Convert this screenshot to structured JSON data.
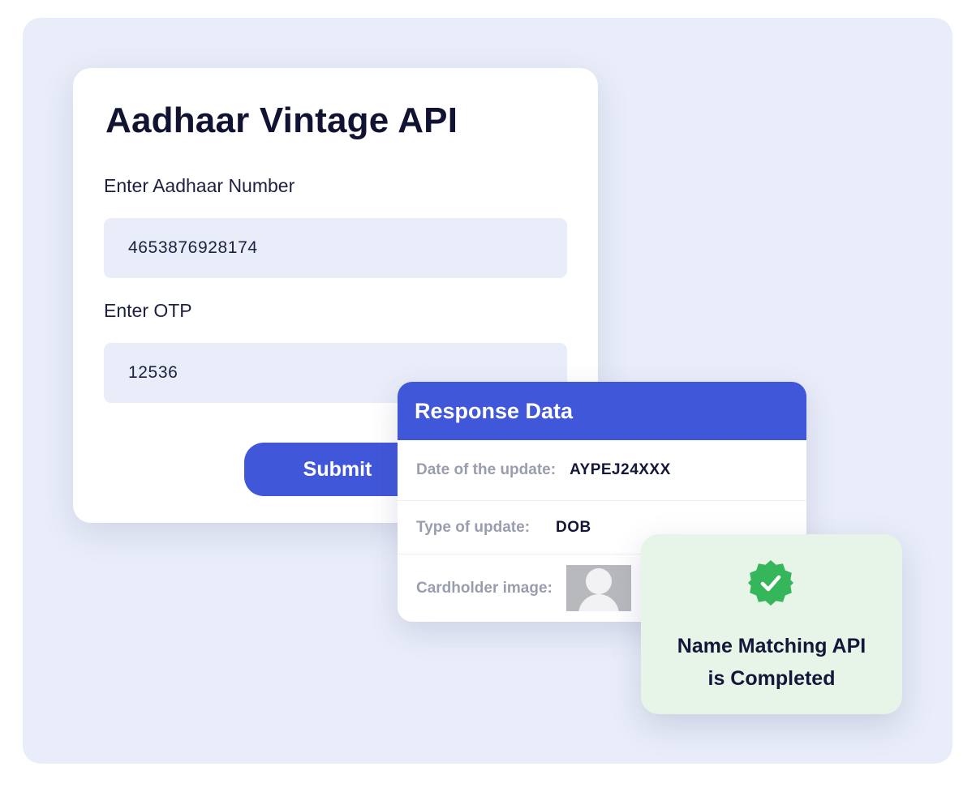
{
  "form": {
    "title": "Aadhaar Vintage API",
    "aadhaar_label": "Enter Aadhaar Number",
    "aadhaar_value": "4653876928174",
    "otp_label": "Enter OTP",
    "otp_value": "12536",
    "submit_label": "Submit"
  },
  "response": {
    "title": "Response Data",
    "rows": [
      {
        "label": "Date of the update:",
        "value": "AYPEJ24XXX"
      },
      {
        "label": "Type of update:",
        "value": "DOB"
      },
      {
        "label": "Cardholder image:",
        "value": ""
      }
    ]
  },
  "status": {
    "line1": "Name Matching API",
    "line2": "is Completed",
    "icon": "verified-check-icon",
    "color": "#35b65a"
  },
  "colors": {
    "accent": "#4057d9",
    "backdrop": "#e9edf9",
    "success_bg": "#e7f4e8"
  }
}
